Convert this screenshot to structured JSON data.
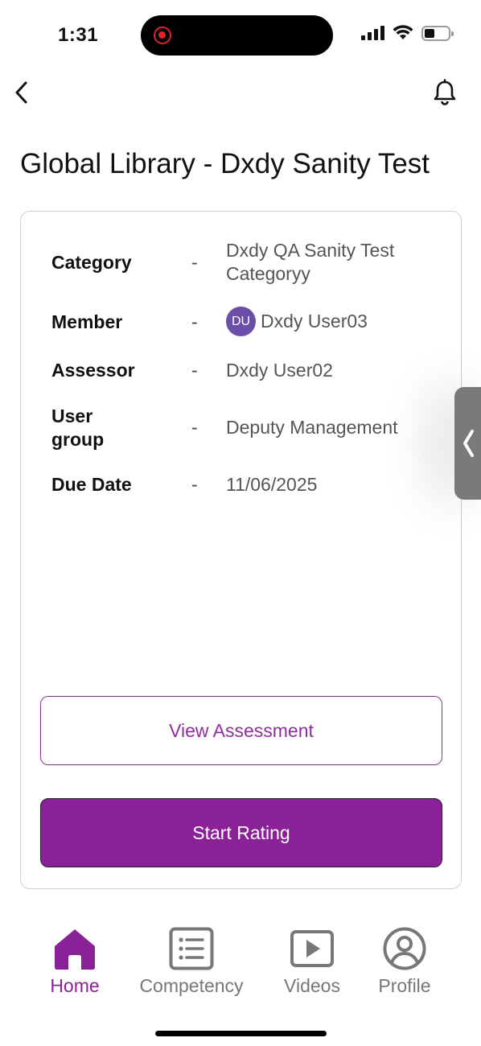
{
  "status_bar": {
    "time": "1:31"
  },
  "header": {
    "title": "Global Library - Dxdy Sanity Test"
  },
  "details": {
    "category": {
      "label": "Category",
      "dash": "-",
      "value": "Dxdy QA Sanity Test Categoryy"
    },
    "member": {
      "label": "Member",
      "dash": "-",
      "avatar_initials": "DU",
      "value": "Dxdy User03"
    },
    "assessor": {
      "label": "Assessor",
      "dash": "-",
      "value": "Dxdy User02"
    },
    "user_group": {
      "label": "User group",
      "dash": "-",
      "value": "Deputy Management"
    },
    "due_date": {
      "label": "Due Date",
      "dash": "-",
      "value": "11/06/2025"
    }
  },
  "actions": {
    "view_assessment": "View Assessment",
    "start_rating": "Start Rating"
  },
  "tabs": [
    {
      "label": "Home",
      "icon": "home-icon",
      "active": true
    },
    {
      "label": "Competency",
      "icon": "list-icon",
      "active": false
    },
    {
      "label": "Videos",
      "icon": "video-icon",
      "active": false
    },
    {
      "label": "Profile",
      "icon": "profile-icon",
      "active": false
    }
  ],
  "colors": {
    "accent": "#8b2196",
    "avatar": "#6c4ea8"
  }
}
